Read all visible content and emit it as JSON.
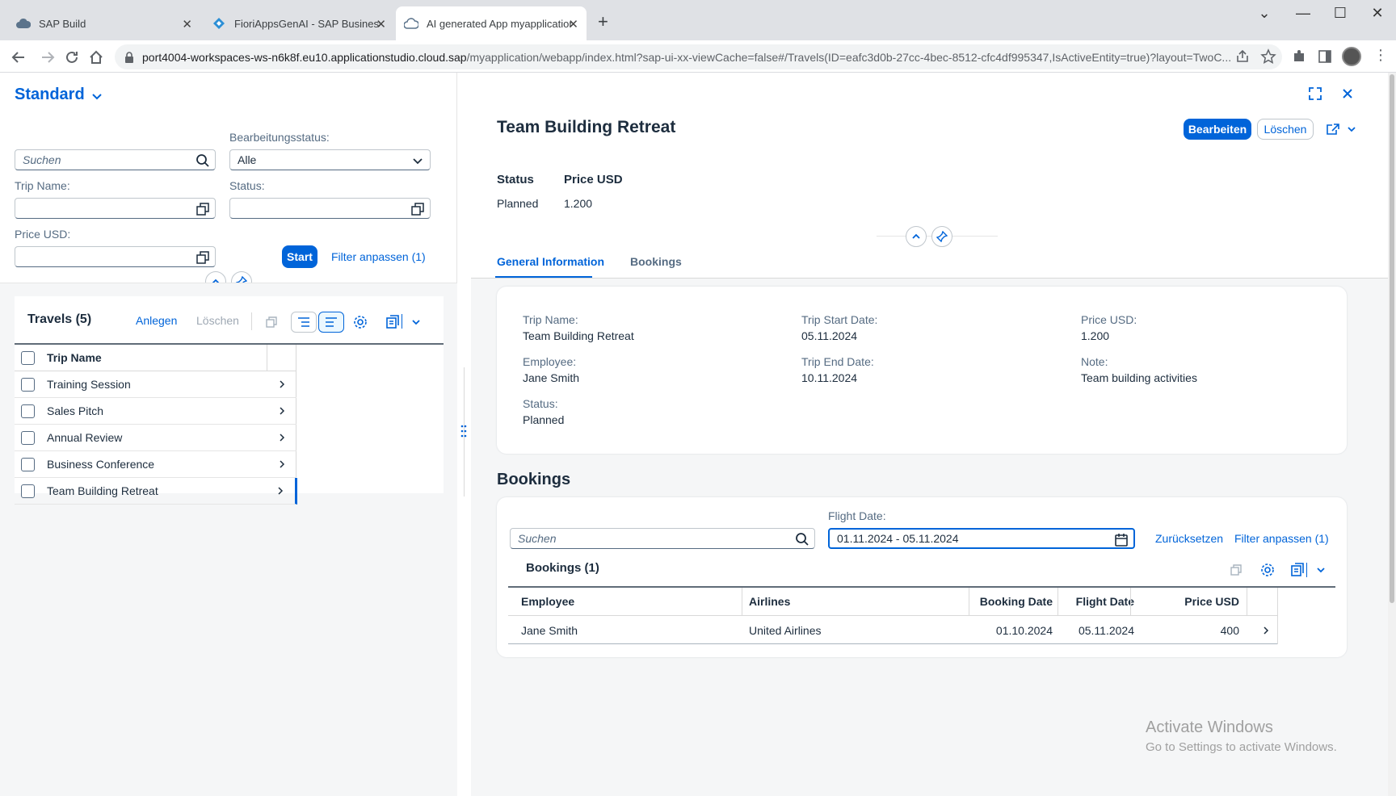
{
  "browser": {
    "tabs": [
      {
        "title": "SAP Build",
        "active": false
      },
      {
        "title": "FioriAppsGenAI - SAP Business A",
        "active": false
      },
      {
        "title": "AI generated App myapplication",
        "active": true
      }
    ],
    "url_host": "port4004-workspaces-ws-n6k8f.eu10.applicationstudio.cloud.sap",
    "url_path": "/myapplication/webapp/index.html?sap-ui-xx-viewCache=false#/Travels(ID=eafc3d0b-27cc-4bec-8512-cfc4df995347,IsActiveEntity=true)?layout=TwoC..."
  },
  "filterbar": {
    "variant": "Standard",
    "search_placeholder": "Suchen",
    "edit_status_label": "Bearbeitungsstatus:",
    "edit_status_value": "Alle",
    "trip_name_label": "Trip Name:",
    "status_label": "Status:",
    "price_label": "Price USD:",
    "start_button": "Start",
    "adapt_filters": "Filter anpassen (1)"
  },
  "list": {
    "title": "Travels (5)",
    "create": "Anlegen",
    "delete": "Löschen",
    "column_header": "Trip Name",
    "rows": [
      "Training Session",
      "Sales Pitch",
      "Annual Review",
      "Business Conference",
      "Team Building Retreat"
    ]
  },
  "detail": {
    "title": "Team Building Retreat",
    "edit_button": "Bearbeiten",
    "delete_button": "Löschen",
    "header_status_label": "Status",
    "header_status_value": "Planned",
    "header_price_label": "Price USD",
    "header_price_value": "1.200",
    "tabs": [
      "General Information",
      "Bookings"
    ],
    "general": {
      "trip_name_label": "Trip Name:",
      "trip_name_value": "Team Building Retreat",
      "employee_label": "Employee:",
      "employee_value": "Jane Smith",
      "status_label": "Status:",
      "status_value": "Planned",
      "start_label": "Trip Start Date:",
      "start_value": "05.11.2024",
      "end_label": "Trip End Date:",
      "end_value": "10.11.2024",
      "price_label": "Price USD:",
      "price_value": "1.200",
      "note_label": "Note:",
      "note_value": "Team building activities"
    },
    "bookings_section_title": "Bookings",
    "bookings_search_placeholder": "Suchen",
    "flight_date_label": "Flight Date:",
    "flight_date_value": "01.11.2024 - 05.11.2024",
    "reset": "Zurücksetzen",
    "adapt_filters": "Filter anpassen (1)",
    "bookings_table_title": "Bookings (1)",
    "columns": [
      "Employee",
      "Airlines",
      "Booking Date",
      "Flight Date",
      "Price USD"
    ],
    "rows": [
      {
        "employee": "Jane Smith",
        "airline": "United Airlines",
        "booking_date": "01.10.2024",
        "flight_date": "05.11.2024",
        "price": "400"
      }
    ]
  },
  "watermark": {
    "line1": "Activate Windows",
    "line2": "Go to Settings to activate Windows."
  },
  "colors": {
    "accent": "#0064d9",
    "text": "#1d2d3e",
    "label": "#556b82"
  }
}
